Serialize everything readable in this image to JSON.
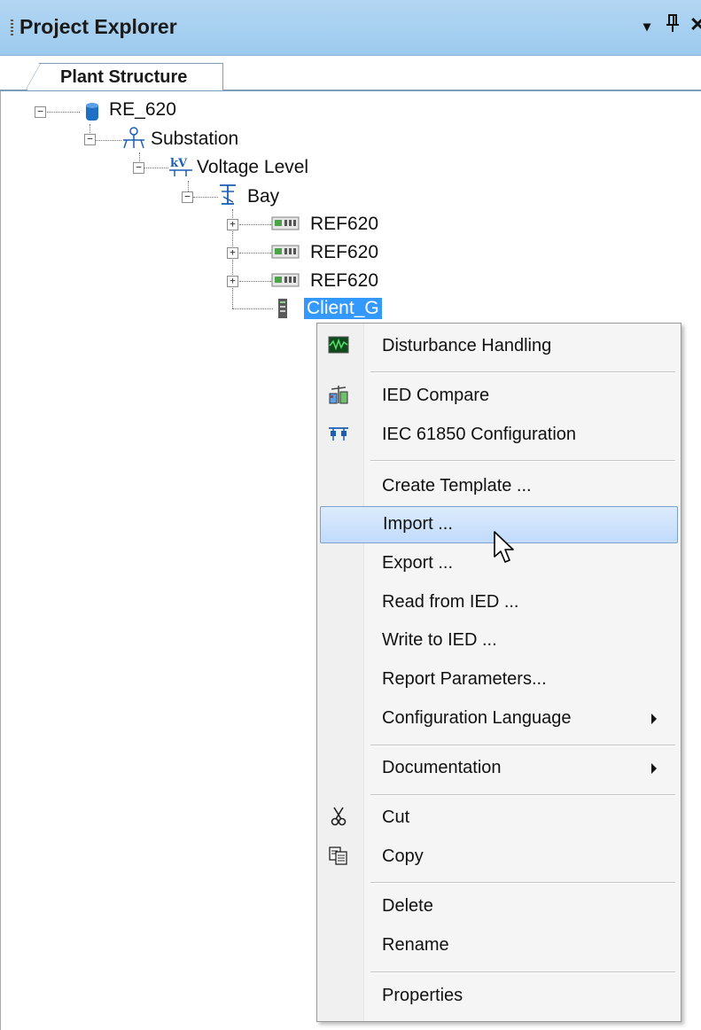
{
  "panel": {
    "title": "Project Explorer",
    "menu_glyph": "▾",
    "pin_glyph": "ᵽ",
    "close_glyph": "✕"
  },
  "tab": {
    "label": "Plant Structure"
  },
  "tree": {
    "root": "RE_620",
    "substation": "Substation",
    "voltage_level": "Voltage Level",
    "bay": "Bay",
    "ied1": "REF620",
    "ied2": "REF620",
    "ied3": "REF620",
    "client": "Client_G",
    "expand_glyph": "+",
    "collapse_glyph": "−"
  },
  "context_menu": {
    "items": [
      {
        "label": "Disturbance Handling",
        "icon": "waveform-icon"
      },
      {
        "label": "IED Compare",
        "icon": "compare-icon"
      },
      {
        "label": "IEC 61850 Configuration",
        "icon": "network-icon"
      },
      {
        "label": "Create Template ..."
      },
      {
        "label": "Import ...",
        "hover": true
      },
      {
        "label": "Export ..."
      },
      {
        "label": "Read from IED ..."
      },
      {
        "label": "Write to IED ..."
      },
      {
        "label": "Report Parameters..."
      },
      {
        "label": "Configuration Language",
        "submenu": true
      },
      {
        "label": "Documentation",
        "submenu": true
      },
      {
        "label": "Cut",
        "icon": "scissors-icon"
      },
      {
        "label": "Copy",
        "icon": "copy-icon"
      },
      {
        "label": "Delete"
      },
      {
        "label": "Rename"
      },
      {
        "label": "Properties"
      }
    ]
  },
  "colors": {
    "titlebar": "#9ccaee",
    "selection": "#3399ff",
    "hover_border": "#7da2ce"
  }
}
